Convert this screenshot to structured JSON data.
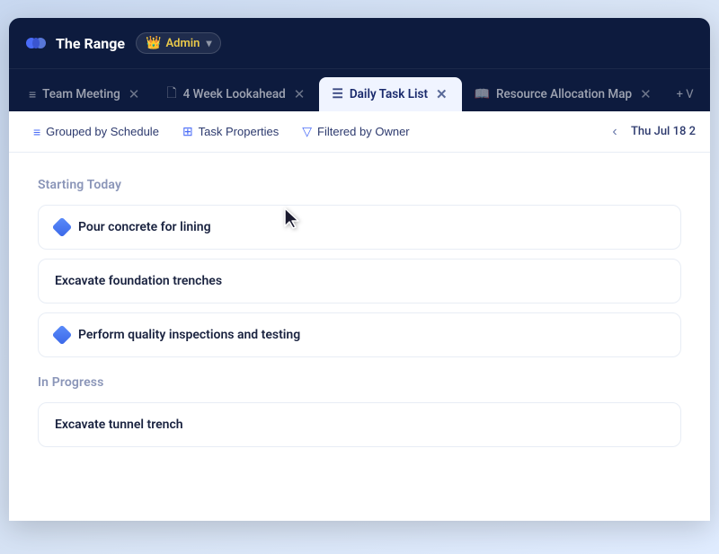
{
  "app": {
    "title": "The Range",
    "admin_label": "Admin"
  },
  "tabs": [
    {
      "id": "team-meeting",
      "label": "Team Meeting",
      "icon": "≡",
      "active": false,
      "closable": true
    },
    {
      "id": "4-week-lookahead",
      "label": "4 Week Lookahead",
      "icon": "📄",
      "active": false,
      "closable": true
    },
    {
      "id": "daily-task-list",
      "label": "Daily Task List",
      "icon": "☰",
      "active": true,
      "closable": true
    },
    {
      "id": "resource-allocation-map",
      "label": "Resource Allocation Map",
      "icon": "📖",
      "active": false,
      "closable": true
    }
  ],
  "tab_add_label": "+ V",
  "toolbar": {
    "grouped_by_schedule": "Grouped by Schedule",
    "task_properties": "Task Properties",
    "filtered_by_owner": "Filtered by Owner",
    "date": "Thu Jul 18 2",
    "nav_left_label": "‹",
    "nav_right_label": "›"
  },
  "sections": [
    {
      "id": "starting-today",
      "header": "Starting Today",
      "tasks": [
        {
          "id": "task-1",
          "name": "Pour concrete for lining",
          "has_icon": true
        },
        {
          "id": "task-2",
          "name": "Excavate foundation trenches",
          "has_icon": false
        },
        {
          "id": "task-3",
          "name": "Perform quality inspections and testing",
          "has_icon": true
        }
      ]
    },
    {
      "id": "in-progress",
      "header": "In Progress",
      "tasks": [
        {
          "id": "task-4",
          "name": "Excavate tunnel trench",
          "has_icon": false
        }
      ]
    }
  ]
}
